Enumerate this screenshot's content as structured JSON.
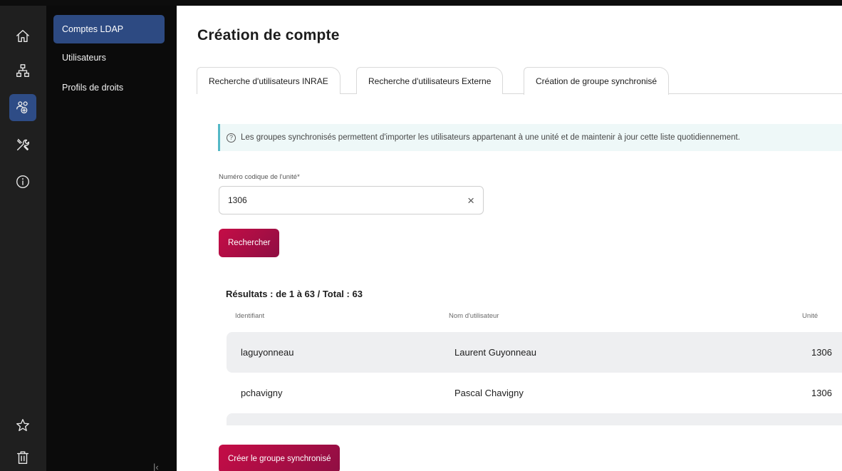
{
  "rail": {
    "items": [
      {
        "icon": "home-icon"
      },
      {
        "icon": "sitemap-icon"
      },
      {
        "icon": "user-group-add-icon",
        "active": true
      },
      {
        "icon": "tools-icon"
      },
      {
        "icon": "info-icon"
      },
      {
        "icon": "star-icon"
      },
      {
        "icon": "trash-icon"
      }
    ]
  },
  "subnav": {
    "items": [
      {
        "label": "Comptes LDAP",
        "active": true
      },
      {
        "label": "Utilisateurs"
      },
      {
        "label": "Profils de droits"
      }
    ],
    "collapse_icon": "collapse-left-icon"
  },
  "page": {
    "title": "Création de compte"
  },
  "tabs": [
    {
      "label": "Recherche d'utilisateurs INRAE"
    },
    {
      "label": "Recherche d'utilisateurs Externe"
    },
    {
      "label": "Création de groupe synchronisé",
      "active": true
    }
  ],
  "info": {
    "icon_glyph": "?",
    "text": "Les groupes synchronisés permettent d'importer les utilisateurs appartenant à une unité et de maintenir à jour cette liste quotidiennement."
  },
  "unit_field": {
    "label": "Numéro codique de l'unité*",
    "value": "1306",
    "clear_glyph": "×"
  },
  "search_button": {
    "label": "Rechercher"
  },
  "results": {
    "title": "Résultats : de 1 à 63 / Total : 63",
    "columns": {
      "id": "Identifiant",
      "name": "Nom d'utilisateur",
      "unit": "Unité"
    },
    "rows": [
      {
        "id": "laguyonneau",
        "name": "Laurent Guyonneau",
        "unit": "1306"
      },
      {
        "id": "pchavigny",
        "name": "Pascal Chavigny",
        "unit": "1306"
      },
      {
        "id": "",
        "name": "",
        "unit": ""
      }
    ]
  },
  "create_button": {
    "label": "Créer le groupe synchronisé"
  },
  "colors": {
    "accent_primary": "#c50d46",
    "nav_active": "#2d4a82",
    "info_border": "#54b8c6"
  }
}
